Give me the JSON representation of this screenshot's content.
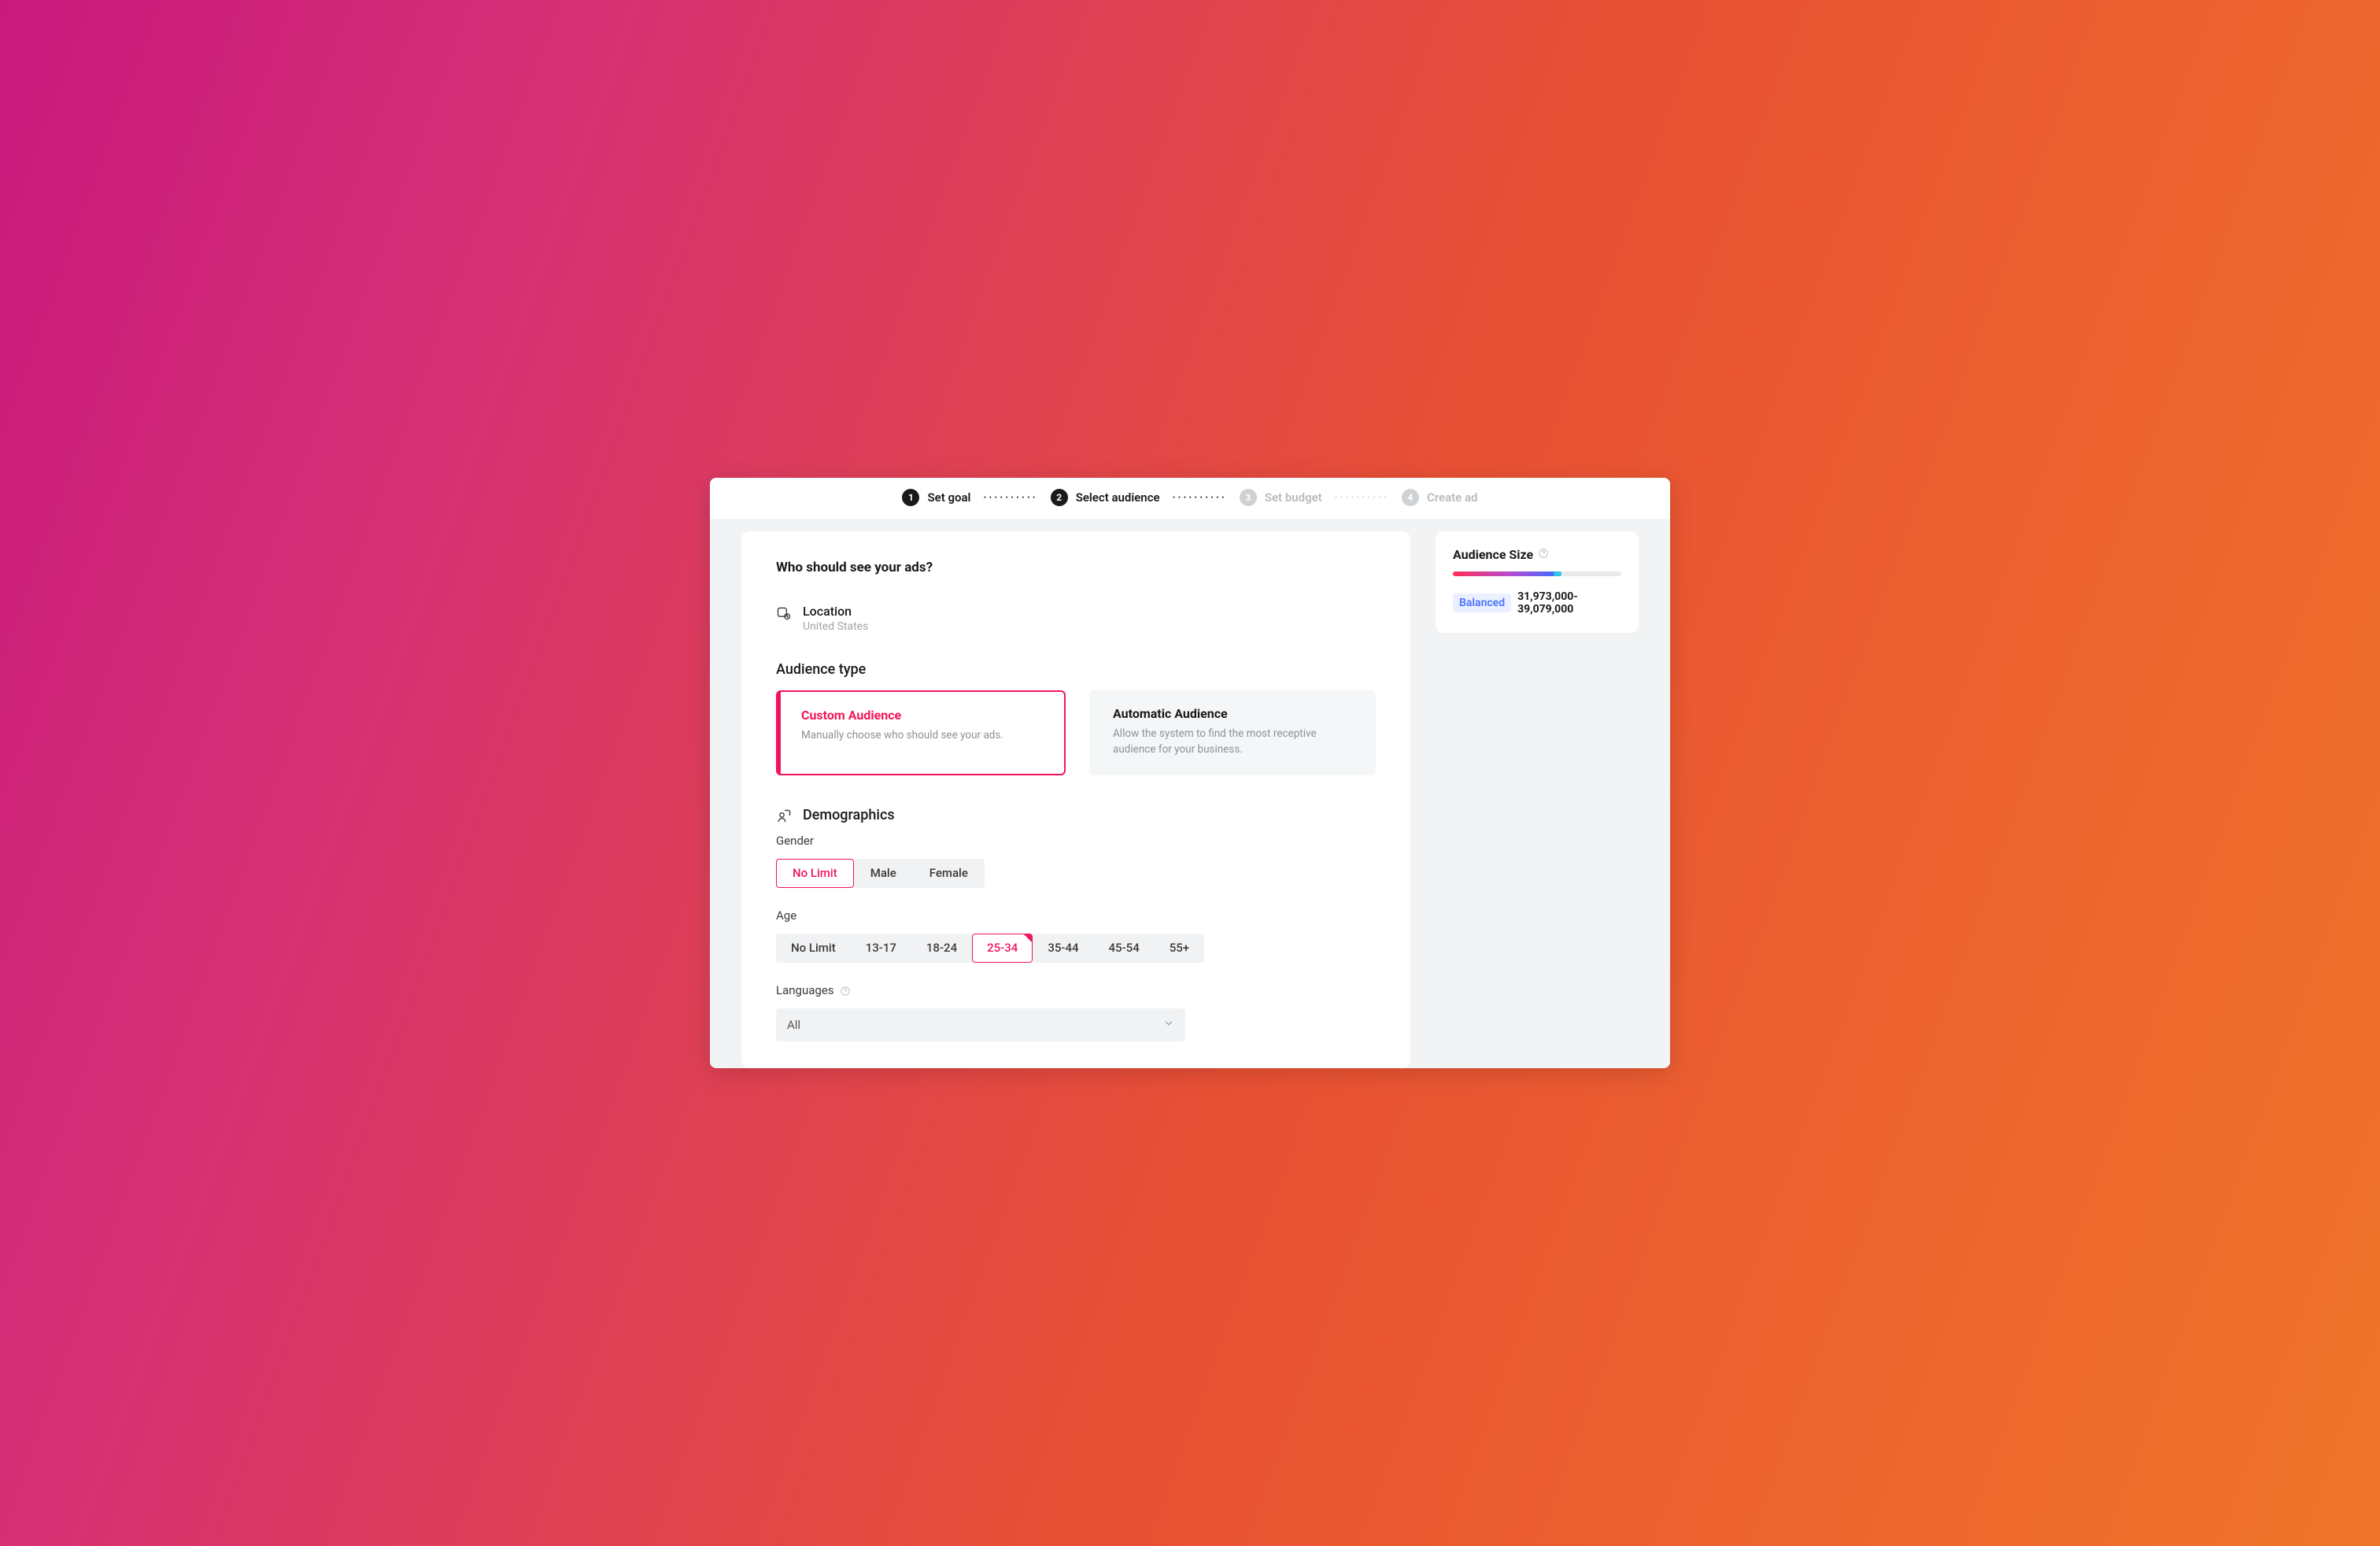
{
  "stepper": {
    "steps": [
      {
        "num": "1",
        "label": "Set goal",
        "active": true
      },
      {
        "num": "2",
        "label": "Select audience",
        "active": true
      },
      {
        "num": "3",
        "label": "Set budget",
        "active": false
      },
      {
        "num": "4",
        "label": "Create ad",
        "active": false
      }
    ]
  },
  "page": {
    "title": "Who should see your ads?"
  },
  "location": {
    "label": "Location",
    "value": "United States"
  },
  "audience_type": {
    "heading": "Audience type",
    "options": [
      {
        "title": "Custom Audience",
        "desc": "Manually choose who should see your ads.",
        "selected": true
      },
      {
        "title": "Automatic Audience",
        "desc": "Allow the system to find the most receptive audience for your business.",
        "selected": false
      }
    ]
  },
  "demographics": {
    "heading": "Demographics",
    "gender": {
      "label": "Gender",
      "options": [
        "No Limit",
        "Male",
        "Female"
      ],
      "selected": "No Limit"
    },
    "age": {
      "label": "Age",
      "options": [
        "No Limit",
        "13-17",
        "18-24",
        "25-34",
        "35-44",
        "45-54",
        "55+"
      ],
      "selected": "25-34"
    },
    "languages": {
      "label": "Languages",
      "value": "All"
    }
  },
  "audience_size": {
    "title": "Audience Size",
    "status": "Balanced",
    "range": "31,973,000-39,079,000",
    "gauge_pct": 62
  }
}
